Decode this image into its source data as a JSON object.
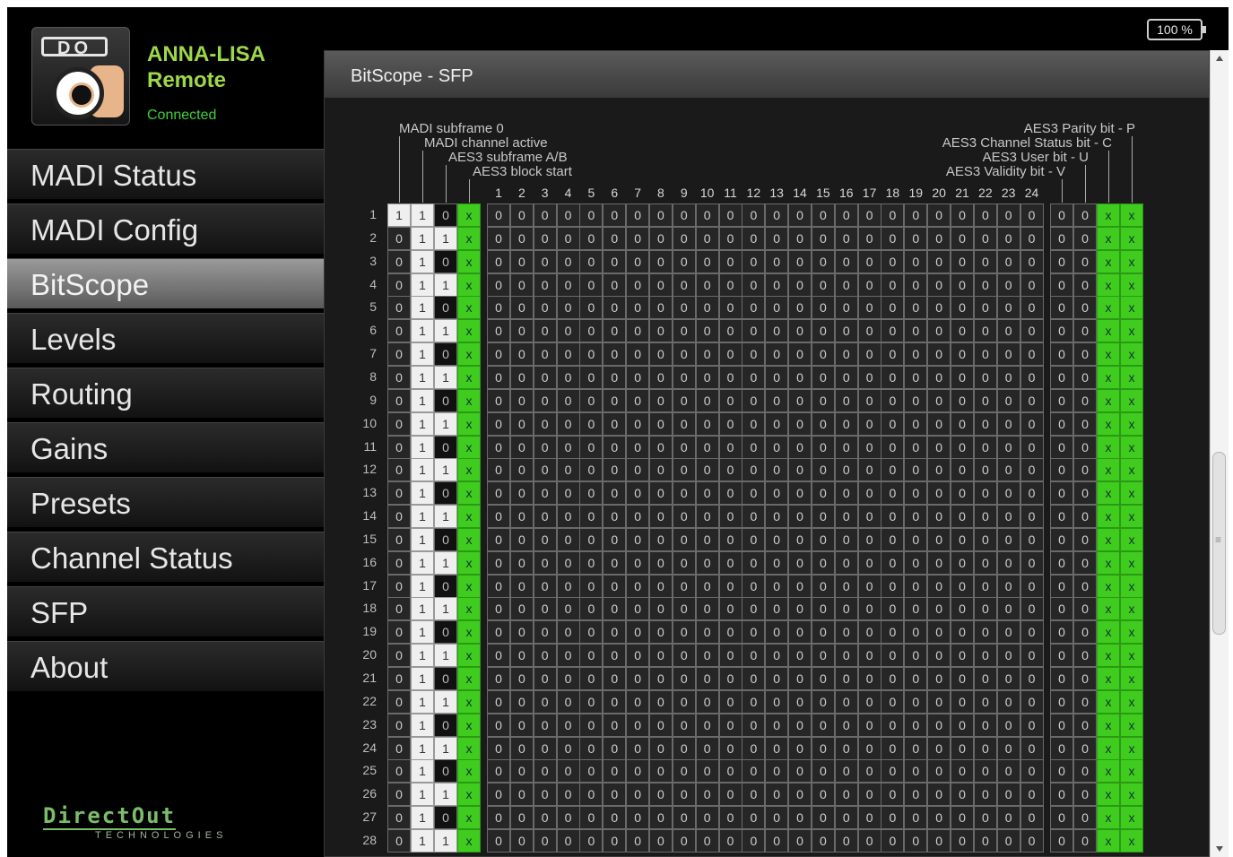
{
  "device": {
    "logo_text": "DO",
    "title_line1": "ANNA-LISA",
    "title_line2": "Remote",
    "status": "Connected"
  },
  "battery": "100 %",
  "nav": {
    "items": [
      "MADI Status",
      "MADI Config",
      "BitScope",
      "Levels",
      "Routing",
      "Gains",
      "Presets",
      "Channel Status",
      "SFP",
      "About"
    ],
    "active": "BitScope"
  },
  "footer": {
    "brand": "DirectOut",
    "sub": "TECHNOLOGIES"
  },
  "panel": {
    "title": "BitScope - SFP",
    "left_labels": [
      "MADI subframe 0",
      "MADI channel active",
      "AES3 subframe A/B",
      "AES3 block start"
    ],
    "right_labels": [
      "AES3 Parity bit - P",
      "AES3 Channel Status bit - C",
      "AES3 User bit - U",
      "AES3 Validity bit - V"
    ],
    "bit_columns": [
      "1",
      "2",
      "3",
      "4",
      "5",
      "6",
      "7",
      "8",
      "9",
      "10",
      "11",
      "12",
      "13",
      "14",
      "15",
      "16",
      "17",
      "18",
      "19",
      "20",
      "21",
      "22",
      "23",
      "24"
    ],
    "row_labels": [
      "1",
      "2",
      "3",
      "4",
      "5",
      "6",
      "7",
      "8",
      "9",
      "10",
      "11",
      "12",
      "13",
      "14",
      "15",
      "16",
      "17",
      "18",
      "19",
      "20",
      "21",
      "22",
      "23",
      "24",
      "25",
      "26",
      "27",
      "28"
    ],
    "header_bits": [
      "0",
      "1",
      "1",
      "0"
    ],
    "audio_bit": "0",
    "v_bit": "0",
    "u_bit": "0",
    "c_bit": "x",
    "p_bit": "x",
    "colors": {
      "green": "#3fcc1e",
      "white": "#efefef",
      "connected": "#3fd13a",
      "title": "#9ed84a"
    }
  }
}
